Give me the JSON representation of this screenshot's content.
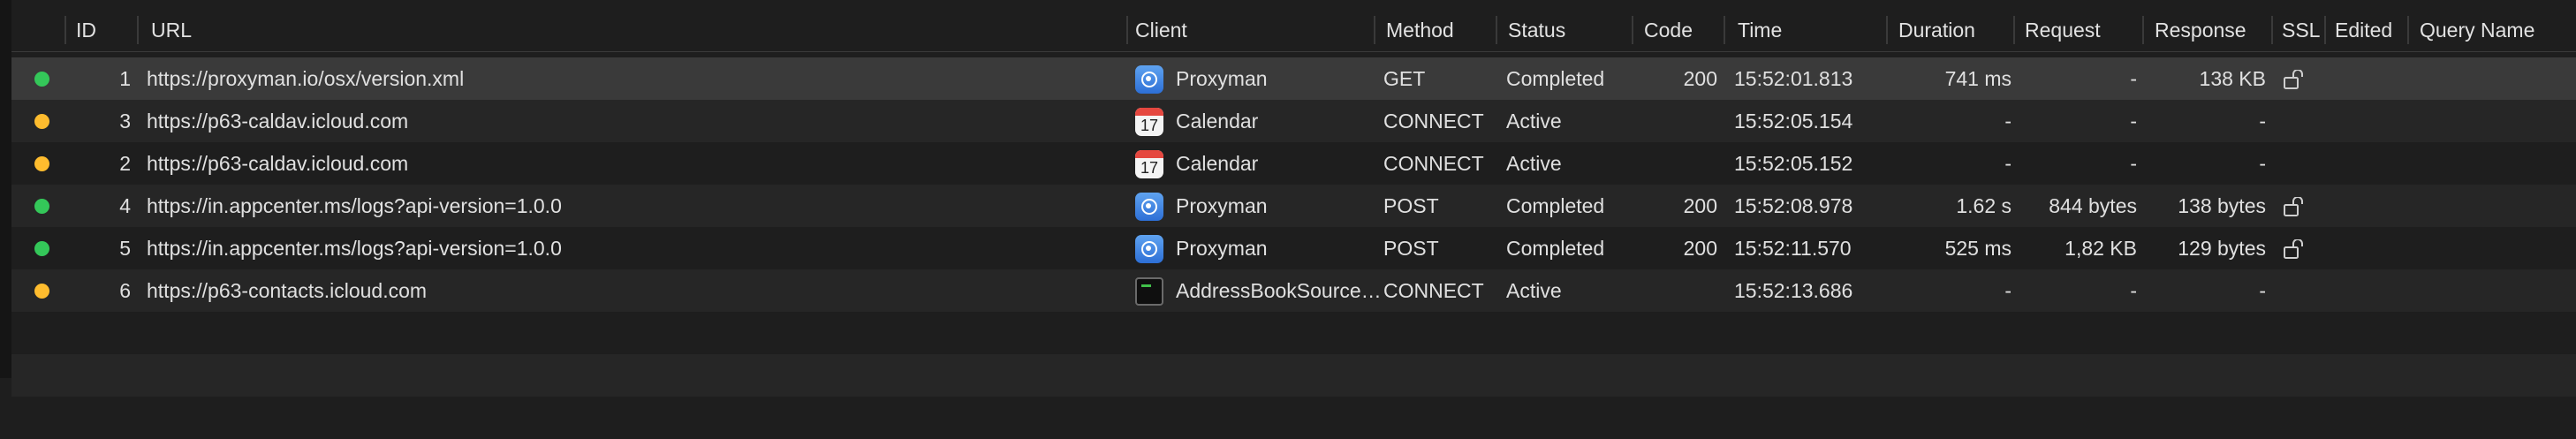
{
  "columns": {
    "id": "ID",
    "url": "URL",
    "client": "Client",
    "method": "Method",
    "status": "Status",
    "code": "Code",
    "time": "Time",
    "duration": "Duration",
    "request": "Request",
    "response": "Response",
    "ssl": "SSL",
    "edited": "Edited",
    "query_name": "Query Name"
  },
  "colors": {
    "completed": "#34c759",
    "active": "#febc2e"
  },
  "rows": [
    {
      "id": "1",
      "url": "https://proxyman.io/osx/version.xml",
      "client": "Proxyman",
      "client_icon": "proxyman-icon",
      "method": "GET",
      "status": "Completed",
      "code": "200",
      "time": "15:52:01.813",
      "duration": "741 ms",
      "request": "-",
      "response": "138 KB",
      "ssl": "unlocked-icon",
      "state": "completed"
    },
    {
      "id": "3",
      "url": "https://p63-caldav.icloud.com",
      "client": "Calendar",
      "client_icon": "calendar-icon",
      "calendar_day": "17",
      "method": "CONNECT",
      "status": "Active",
      "code": "",
      "time": "15:52:05.154",
      "duration": "-",
      "request": "-",
      "response": "-",
      "ssl": "",
      "state": "active"
    },
    {
      "id": "2",
      "url": "https://p63-caldav.icloud.com",
      "client": "Calendar",
      "client_icon": "calendar-icon",
      "calendar_day": "17",
      "method": "CONNECT",
      "status": "Active",
      "code": "",
      "time": "15:52:05.152",
      "duration": "-",
      "request": "-",
      "response": "-",
      "ssl": "",
      "state": "active"
    },
    {
      "id": "4",
      "url": "https://in.appcenter.ms/logs?api-version=1.0.0",
      "client": "Proxyman",
      "client_icon": "proxyman-icon",
      "method": "POST",
      "status": "Completed",
      "code": "200",
      "time": "15:52:08.978",
      "duration": "1.62 s",
      "request": "844 bytes",
      "response": "138 bytes",
      "ssl": "unlocked-icon",
      "state": "completed"
    },
    {
      "id": "5",
      "url": "https://in.appcenter.ms/logs?api-version=1.0.0",
      "client": "Proxyman",
      "client_icon": "proxyman-icon",
      "method": "POST",
      "status": "Completed",
      "code": "200",
      "time": "15:52:11.570",
      "duration": "525 ms",
      "request": "1,82 KB",
      "response": "129 bytes",
      "ssl": "unlocked-icon",
      "state": "completed"
    },
    {
      "id": "6",
      "url": "https://p63-contacts.icloud.com",
      "client": "AddressBookSource…",
      "client_icon": "terminal-icon",
      "method": "CONNECT",
      "status": "Active",
      "code": "",
      "time": "15:52:13.686",
      "duration": "-",
      "request": "-",
      "response": "-",
      "ssl": "",
      "state": "active"
    }
  ]
}
